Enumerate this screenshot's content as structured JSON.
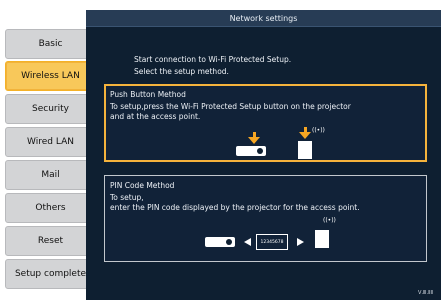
{
  "header": {
    "title": "Network settings"
  },
  "sidebar": {
    "items": [
      {
        "label": "Basic",
        "active": false
      },
      {
        "label": "Wireless LAN",
        "active": true
      },
      {
        "label": "Security",
        "active": false
      },
      {
        "label": "Wired LAN",
        "active": false
      },
      {
        "label": "Mail",
        "active": false
      },
      {
        "label": "Others",
        "active": false
      },
      {
        "label": "Reset",
        "active": false
      },
      {
        "label": "Setup complete",
        "active": false
      }
    ]
  },
  "main": {
    "intro_line_1": "Start connection to Wi-Fi Protected Setup.",
    "intro_line_2": "Select the setup method.",
    "push_button": {
      "title": "Push Button Method",
      "text_1": "To setup,press the Wi-Fi Protected Setup button on the projector",
      "text_2": "and at the access point."
    },
    "pin_code": {
      "title": "PIN Code Method",
      "text_1": "To setup,",
      "text_2": "enter the PIN code displayed by the projector for the access point.",
      "code": "12345678"
    }
  },
  "status": {
    "version": "Ⅴ.Ⅲ.ⅡⅡ"
  },
  "icons": {
    "wave": "((•))"
  },
  "colors": {
    "accent": "#f6a623",
    "background": "#0e1f31",
    "title_bar": "#273c55"
  }
}
